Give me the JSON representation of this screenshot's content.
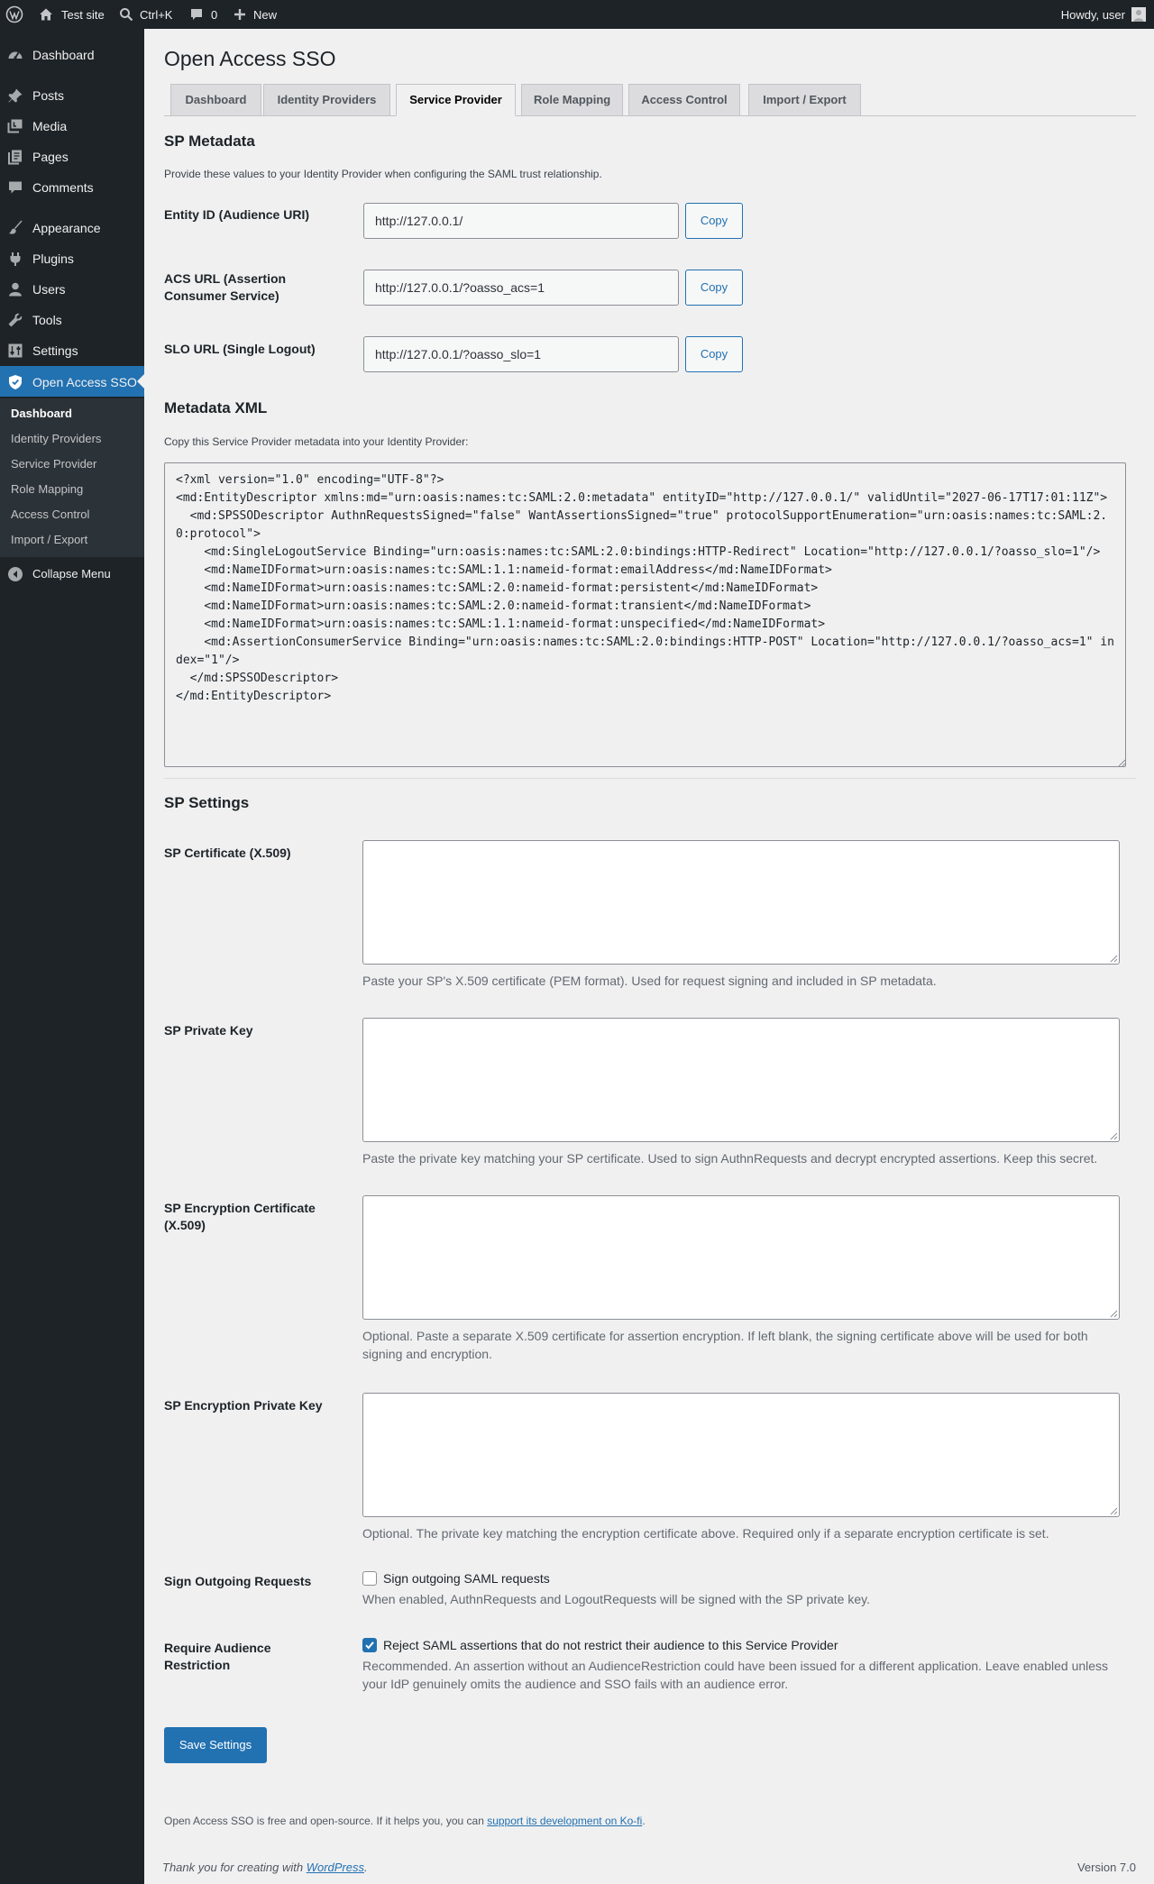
{
  "adminbar": {
    "site_name": "Test site",
    "search_shortcut": "Ctrl+K",
    "comments_count": "0",
    "new_label": "New",
    "howdy": "Howdy, user"
  },
  "sidebar": {
    "items": [
      {
        "label": "Dashboard",
        "icon": "dashboard-icon"
      },
      {
        "label": "Posts",
        "icon": "pin-icon"
      },
      {
        "label": "Media",
        "icon": "media-icon"
      },
      {
        "label": "Pages",
        "icon": "pages-icon"
      },
      {
        "label": "Comments",
        "icon": "comment-icon"
      },
      {
        "label": "Appearance",
        "icon": "brush-icon"
      },
      {
        "label": "Plugins",
        "icon": "plug-icon"
      },
      {
        "label": "Users",
        "icon": "user-icon"
      },
      {
        "label": "Tools",
        "icon": "wrench-icon"
      },
      {
        "label": "Settings",
        "icon": "settings-icon"
      },
      {
        "label": "Open Access SSO",
        "icon": "shield-icon"
      }
    ],
    "submenu": [
      "Dashboard",
      "Identity Providers",
      "Service Provider",
      "Role Mapping",
      "Access Control",
      "Import / Export"
    ],
    "collapse_label": "Collapse Menu"
  },
  "page": {
    "title": "Open Access SSO",
    "tabs": [
      "Dashboard",
      "Identity Providers",
      "Service Provider",
      "Role Mapping",
      "Access Control",
      "Import / Export"
    ],
    "active_tab": "Service Provider"
  },
  "sp_metadata": {
    "heading": "SP Metadata",
    "description": "Provide these values to your Identity Provider when configuring the SAML trust relationship.",
    "rows": [
      {
        "label": "Entity ID (Audience URI)",
        "value": "http://127.0.0.1/",
        "button": "Copy"
      },
      {
        "label": "ACS URL (Assertion Consumer Service)",
        "value": "http://127.0.0.1/?oasso_acs=1",
        "button": "Copy"
      },
      {
        "label": "SLO URL (Single Logout)",
        "value": "http://127.0.0.1/?oasso_slo=1",
        "button": "Copy"
      }
    ]
  },
  "metadata_xml": {
    "heading": "Metadata XML",
    "description": "Copy this Service Provider metadata into your Identity Provider:",
    "content": "<?xml version=\"1.0\" encoding=\"UTF-8\"?>\n<md:EntityDescriptor xmlns:md=\"urn:oasis:names:tc:SAML:2.0:metadata\" entityID=\"http://127.0.0.1/\" validUntil=\"2027-06-17T17:01:11Z\">\n  <md:SPSSODescriptor AuthnRequestsSigned=\"false\" WantAssertionsSigned=\"true\" protocolSupportEnumeration=\"urn:oasis:names:tc:SAML:2.0:protocol\">\n    <md:SingleLogoutService Binding=\"urn:oasis:names:tc:SAML:2.0:bindings:HTTP-Redirect\" Location=\"http://127.0.0.1/?oasso_slo=1\"/>\n    <md:NameIDFormat>urn:oasis:names:tc:SAML:1.1:nameid-format:emailAddress</md:NameIDFormat>\n    <md:NameIDFormat>urn:oasis:names:tc:SAML:2.0:nameid-format:persistent</md:NameIDFormat>\n    <md:NameIDFormat>urn:oasis:names:tc:SAML:2.0:nameid-format:transient</md:NameIDFormat>\n    <md:NameIDFormat>urn:oasis:names:tc:SAML:1.1:nameid-format:unspecified</md:NameIDFormat>\n    <md:AssertionConsumerService Binding=\"urn:oasis:names:tc:SAML:2.0:bindings:HTTP-POST\" Location=\"http://127.0.0.1/?oasso_acs=1\" index=\"1\"/>\n  </md:SPSSODescriptor>\n</md:EntityDescriptor>"
  },
  "sp_settings": {
    "heading": "SP Settings",
    "fields": [
      {
        "label": "SP Certificate (X.509)",
        "value": "",
        "description": "Paste your SP's X.509 certificate (PEM format). Used for request signing and included in SP metadata."
      },
      {
        "label": "SP Private Key",
        "value": "",
        "description": "Paste the private key matching your SP certificate. Used to sign AuthnRequests and decrypt encrypted assertions. Keep this secret."
      },
      {
        "label": "SP Encryption Certificate (X.509)",
        "value": "",
        "description": "Optional. Paste a separate X.509 certificate for assertion encryption. If left blank, the signing certificate above will be used for both signing and encryption."
      },
      {
        "label": "SP Encryption Private Key",
        "value": "",
        "description": "Optional. The private key matching the encryption certificate above. Required only if a separate encryption certificate is set."
      }
    ],
    "sign_requests": {
      "label": "Sign Outgoing Requests",
      "checkbox_label": "Sign outgoing SAML requests",
      "checked": false,
      "description": "When enabled, AuthnRequests and LogoutRequests will be signed with the SP private key."
    },
    "audience_restriction": {
      "label": "Require Audience Restriction",
      "checkbox_label": "Reject SAML assertions that do not restrict their audience to this Service Provider",
      "checked": true,
      "description": "Recommended. An assertion without an AudienceRestriction could have been issued for a different application. Leave enabled unless your IdP genuinely omits the audience and SSO fails with an audience error."
    },
    "save_label": "Save Settings"
  },
  "footer": {
    "note_prefix": "Open Access SSO is free and open-source. If it helps you, you can ",
    "note_link": "support its development on Ko-fi",
    "note_suffix": ".",
    "thanks_prefix": "Thank you for creating with ",
    "thanks_link": "WordPress",
    "thanks_suffix": ".",
    "version": "Version 7.0"
  },
  "colors": {
    "accent": "#2271b1",
    "adminbar_bg": "#1d2327",
    "page_bg": "#f0f0f1"
  }
}
